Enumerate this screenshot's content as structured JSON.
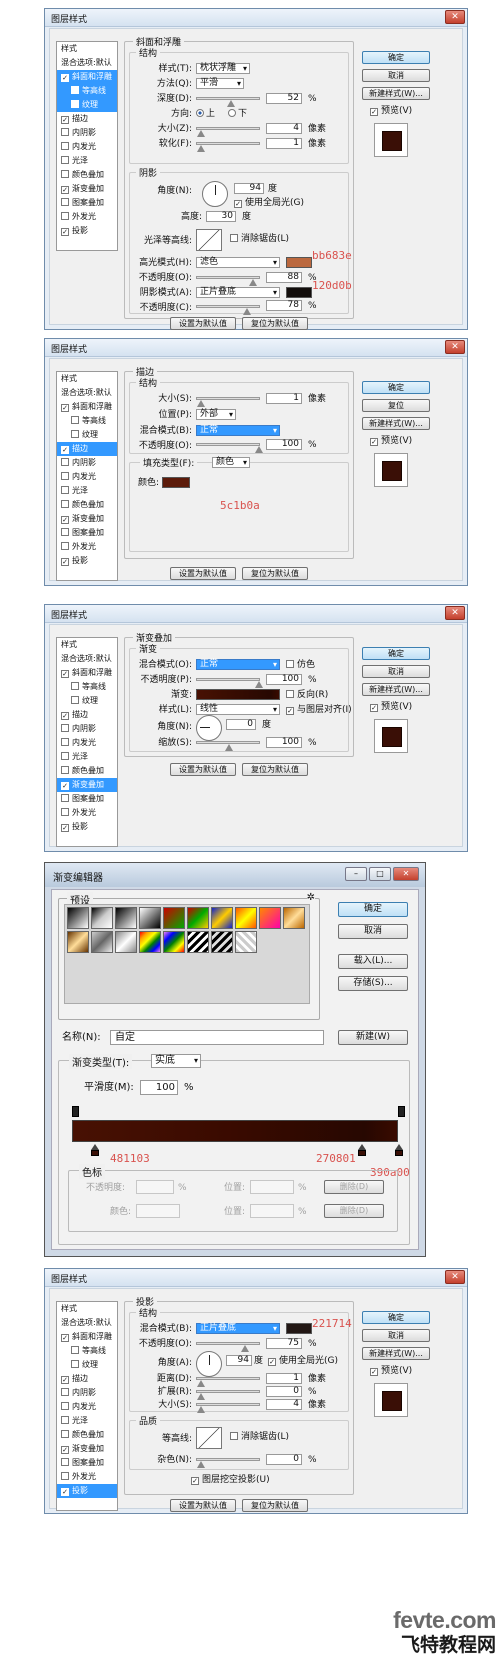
{
  "dialog_title": "图层样式",
  "sidebar": [
    "样式",
    "混合选项:默认",
    "斜面和浮雕",
    "等高线",
    "纹理",
    "描边",
    "内阴影",
    "内发光",
    "光泽",
    "颜色叠加",
    "渐变叠加",
    "图案叠加",
    "外发光",
    "投影"
  ],
  "sidebar_checked": {
    "bevel": true,
    "contour": false,
    "texture": false,
    "stroke": true,
    "inner_shadow": false,
    "inner_glow": false,
    "satin": false,
    "color_overlay": false,
    "gradient_overlay": true,
    "pattern_overlay": false,
    "outer_glow": false,
    "drop_shadow": true
  },
  "buttons": {
    "ok": "确定",
    "cancel": "取消",
    "reset": "复位",
    "new_style": "新建样式(W)...",
    "preview": "预览(V)",
    "set_default": "设置为默认值",
    "reset_default": "复位为默认值"
  },
  "bevel": {
    "panel_title": "斜面和浮雕",
    "structure": "结构",
    "style_label": "样式(T):",
    "style_value": "枕状浮雕",
    "technique_label": "方法(Q):",
    "technique_value": "平滑",
    "depth_label": "深度(D):",
    "depth_value": "52",
    "depth_unit": "%",
    "direction_label": "方向:",
    "dir_up": "上",
    "dir_down": "下",
    "size_label": "大小(Z):",
    "size_value": "4",
    "size_unit": "像素",
    "soften_label": "软化(F):",
    "soften_value": "1",
    "soften_unit": "像素",
    "shading": "阴影",
    "angle_label": "角度(N):",
    "angle_value": "94",
    "angle_unit": "度",
    "global_light": "使用全局光(G)",
    "altitude_label": "高度:",
    "altitude_value": "30",
    "altitude_unit": "度",
    "gloss_label": "光泽等高线:",
    "antialias": "消除锯齿(L)",
    "highlight_label": "高光模式(H):",
    "highlight_value": "滤色",
    "highlight_opacity_label": "不透明度(O):",
    "highlight_opacity_value": "88",
    "shadow_label": "阴影模式(A):",
    "shadow_value": "正片叠底",
    "shadow_opacity_label": "不透明度(C):",
    "shadow_opacity_value": "78",
    "highlight_color": "#bb683e",
    "highlight_anno": "bb683e",
    "shadow_color": "#120d0b",
    "shadow_anno": "120d0b"
  },
  "stroke": {
    "panel_title": "描边",
    "structure": "结构",
    "size_label": "大小(S):",
    "size_value": "1",
    "size_unit": "像素",
    "position_label": "位置(P):",
    "position_value": "外部",
    "blend_label": "混合模式(B):",
    "blend_value": "正常",
    "opacity_label": "不透明度(O):",
    "opacity_value": "100",
    "opacity_unit": "%",
    "fill_label": "填充类型(F):",
    "fill_value": "颜色",
    "color_label": "颜色:",
    "color": "#5c1b0a",
    "color_anno": "5c1b0a"
  },
  "gradient_overlay": {
    "panel_title": "渐变叠加",
    "group": "渐变",
    "blend_label": "混合模式(O):",
    "blend_value": "正常",
    "dither": "仿色",
    "opacity_label": "不透明度(P):",
    "opacity_value": "100",
    "opacity_unit": "%",
    "gradient_label": "渐变:",
    "reverse": "反向(R)",
    "style_label": "样式(L):",
    "style_value": "线性",
    "align": "与图层对齐(I)",
    "angle_label": "角度(N):",
    "angle_value": "0",
    "angle_unit": "度",
    "scale_label": "缩放(S):",
    "scale_value": "100",
    "scale_unit": "%"
  },
  "gradient_editor": {
    "title": "渐变编辑器",
    "presets_label": "预设",
    "ok": "确定",
    "cancel": "取消",
    "load": "载入(L)...",
    "save": "存储(S)...",
    "name_label": "名称(N):",
    "name_value": "自定",
    "new": "新建(W)",
    "type_label": "渐变类型(T):",
    "type_value": "实底",
    "smooth_label": "平滑度(M):",
    "smooth_value": "100",
    "smooth_unit": "%",
    "stops_group": "色标",
    "opacity_label": "不透明度:",
    "location_label": "位置:",
    "color_label": "颜色:",
    "delete": "删除(D)",
    "pct": "%",
    "stop_annos": [
      "481103",
      "270801",
      "390a00"
    ],
    "stop_colors": [
      "#481103",
      "#270801",
      "#390a00"
    ]
  },
  "drop_shadow": {
    "panel_title": "投影",
    "structure": "结构",
    "blend_label": "混合模式(B):",
    "blend_value": "正片叠底",
    "opacity_label": "不透明度(O):",
    "opacity_value": "75",
    "opacity_unit": "%",
    "angle_label": "角度(A):",
    "angle_value": "94",
    "angle_unit": "度",
    "global_light": "使用全局光(G)",
    "distance_label": "距离(D):",
    "distance_value": "1",
    "distance_unit": "像素",
    "spread_label": "扩展(R):",
    "spread_value": "0",
    "spread_unit": "%",
    "size_label": "大小(S):",
    "size_value": "4",
    "size_unit": "像素",
    "quality": "品质",
    "contour_label": "等高线:",
    "antialias": "消除锯齿(L)",
    "noise_label": "杂色(N):",
    "noise_value": "0",
    "noise_unit": "%",
    "knockout": "图层挖空投影(U)",
    "color": "#221714",
    "color_anno": "221714"
  },
  "watermark": {
    "site": "fevte.com",
    "name": "飞特教程网"
  }
}
